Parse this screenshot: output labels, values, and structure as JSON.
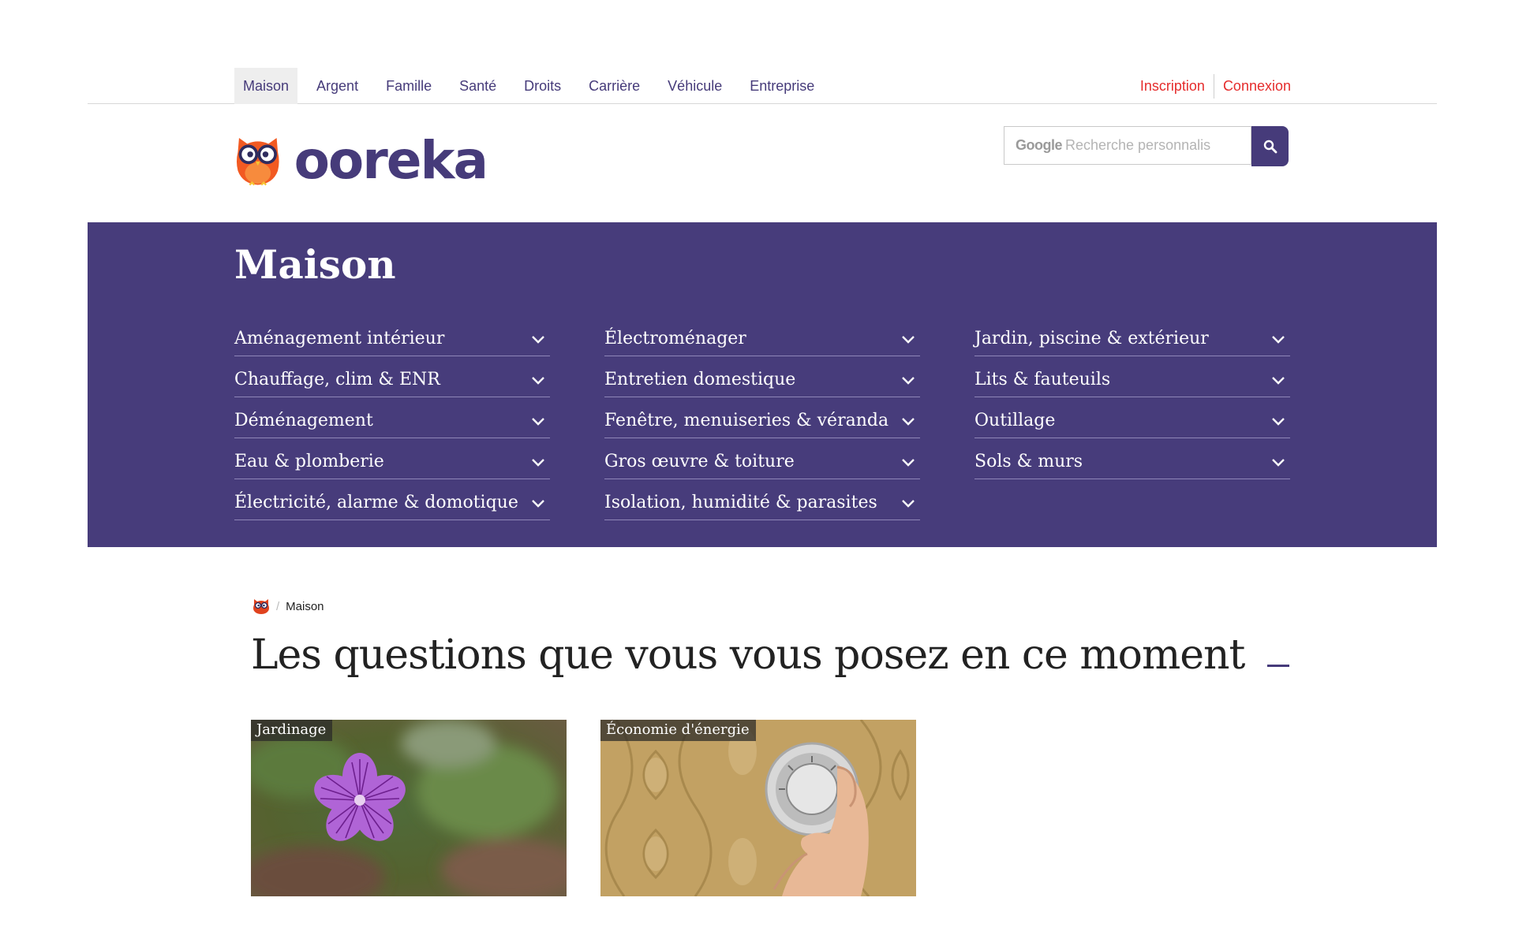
{
  "topnav": {
    "tabs": [
      {
        "label": "Maison",
        "active": true
      },
      {
        "label": "Argent"
      },
      {
        "label": "Famille"
      },
      {
        "label": "Santé"
      },
      {
        "label": "Droits"
      },
      {
        "label": "Carrière"
      },
      {
        "label": "Véhicule"
      },
      {
        "label": "Entreprise"
      }
    ],
    "inscription": "Inscription",
    "connexion": "Connexion"
  },
  "header": {
    "logo_text": "ooreka",
    "search_brand": "Google",
    "search_placeholder": "Recherche personnalis",
    "search_icon": "search-icon"
  },
  "band": {
    "title": "Maison",
    "columns": [
      [
        "Aménagement intérieur",
        "Chauffage, clim & ENR",
        "Déménagement",
        "Eau & plomberie",
        "Électricité, alarme & domotique"
      ],
      [
        "Électroménager",
        "Entretien domestique",
        "Fenêtre, menuiseries & véranda",
        "Gros œuvre & toiture",
        "Isolation, humidité & parasites"
      ],
      [
        "Jardin, piscine & extérieur",
        "Lits & fauteuils",
        "Outillage",
        "Sols & murs"
      ]
    ]
  },
  "breadcrumb": {
    "home_icon": "owl-icon",
    "current": "Maison"
  },
  "section": {
    "title": "Les questions que vous vous posez en ce moment"
  },
  "cards": [
    {
      "tag": "Jardinage"
    },
    {
      "tag": "Économie d'énergie"
    }
  ],
  "colors": {
    "brand_purple": "#473c7b",
    "link_red": "#e52c2c",
    "owl_orange": "#f25a22"
  }
}
